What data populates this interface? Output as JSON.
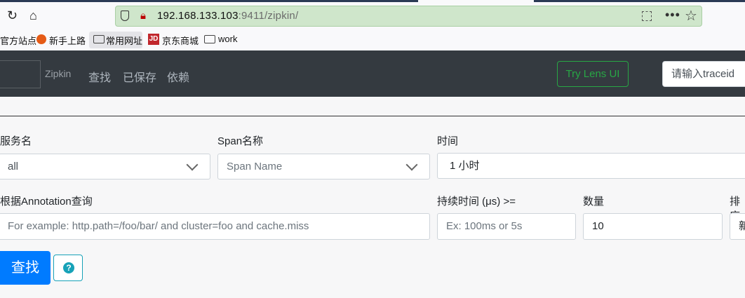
{
  "browser": {
    "url_host": "192.168.133.103",
    "url_path": ":9411/zipkin/",
    "bookmarks": [
      "官方站点",
      "新手上路",
      "常用网址",
      "京东商城",
      "work"
    ]
  },
  "navbar": {
    "brand": "Zipkin",
    "links": [
      "查找",
      "已保存",
      "依赖"
    ],
    "lens_button": "Try Lens UI",
    "traceid_placeholder": "请输入traceid"
  },
  "form": {
    "service_label": "服务名",
    "service_value": "all",
    "span_label": "Span名称",
    "span_placeholder": "Span Name",
    "time_label": "时间",
    "time_value": "1 小时",
    "annotation_label": "根据Annotation查询",
    "annotation_placeholder": "For example: http.path=/foo/bar/ and cluster=foo and cache.miss",
    "duration_label": "持续时间 (μs) >=",
    "duration_placeholder": "Ex: 100ms or 5s",
    "limit_label": "数量",
    "limit_value": "10",
    "sort_label": "排序",
    "sort_value": "新",
    "search_button": "查找",
    "help_icon": "?"
  },
  "colors": {
    "navbar": "#343a40",
    "primary": "#007bff",
    "lens_green": "#28a745",
    "help_teal": "#17a2b8",
    "urlbar": "#cfe6cb"
  }
}
